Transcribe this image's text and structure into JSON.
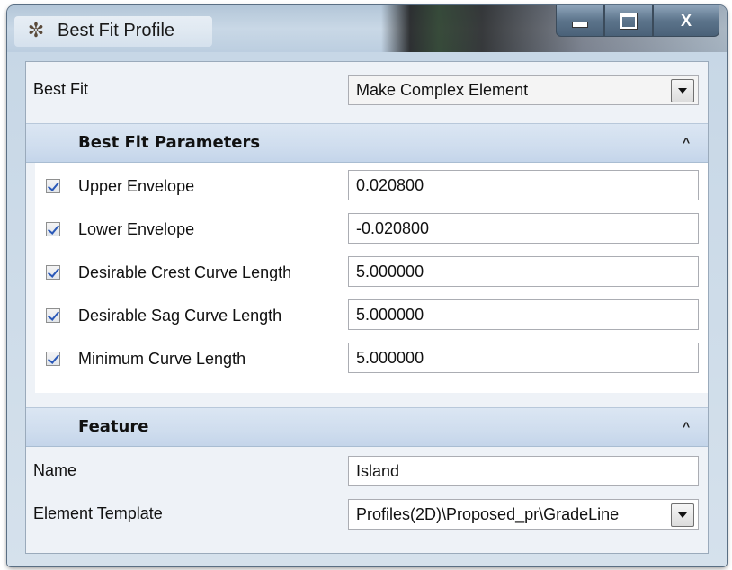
{
  "window": {
    "title": "Best Fit Profile",
    "app_icon": "app-icon",
    "caption_buttons": [
      "minimize-icon",
      "maximize-icon",
      "close-icon"
    ],
    "close_glyph": "X"
  },
  "best_fit": {
    "label": "Best Fit",
    "value": "Make Complex Element"
  },
  "parameters": {
    "header": "Best Fit Parameters",
    "collapse_glyph": "^",
    "rows": [
      {
        "label": "Upper Envelope",
        "value": "0.020800",
        "checked": true
      },
      {
        "label": "Lower Envelope",
        "value": "-0.020800",
        "checked": true
      },
      {
        "label": "Desirable Crest Curve Length",
        "value": "5.000000",
        "checked": true
      },
      {
        "label": "Desirable Sag Curve Length",
        "value": "5.000000",
        "checked": true
      },
      {
        "label": "Minimum Curve Length",
        "value": "5.000000",
        "checked": true
      }
    ]
  },
  "feature": {
    "header": "Feature",
    "collapse_glyph": "^",
    "name_label": "Name",
    "name_value": "Island",
    "template_label": "Element Template",
    "template_value": "Profiles(2D)\\Proposed_pr\\GradeLine"
  }
}
